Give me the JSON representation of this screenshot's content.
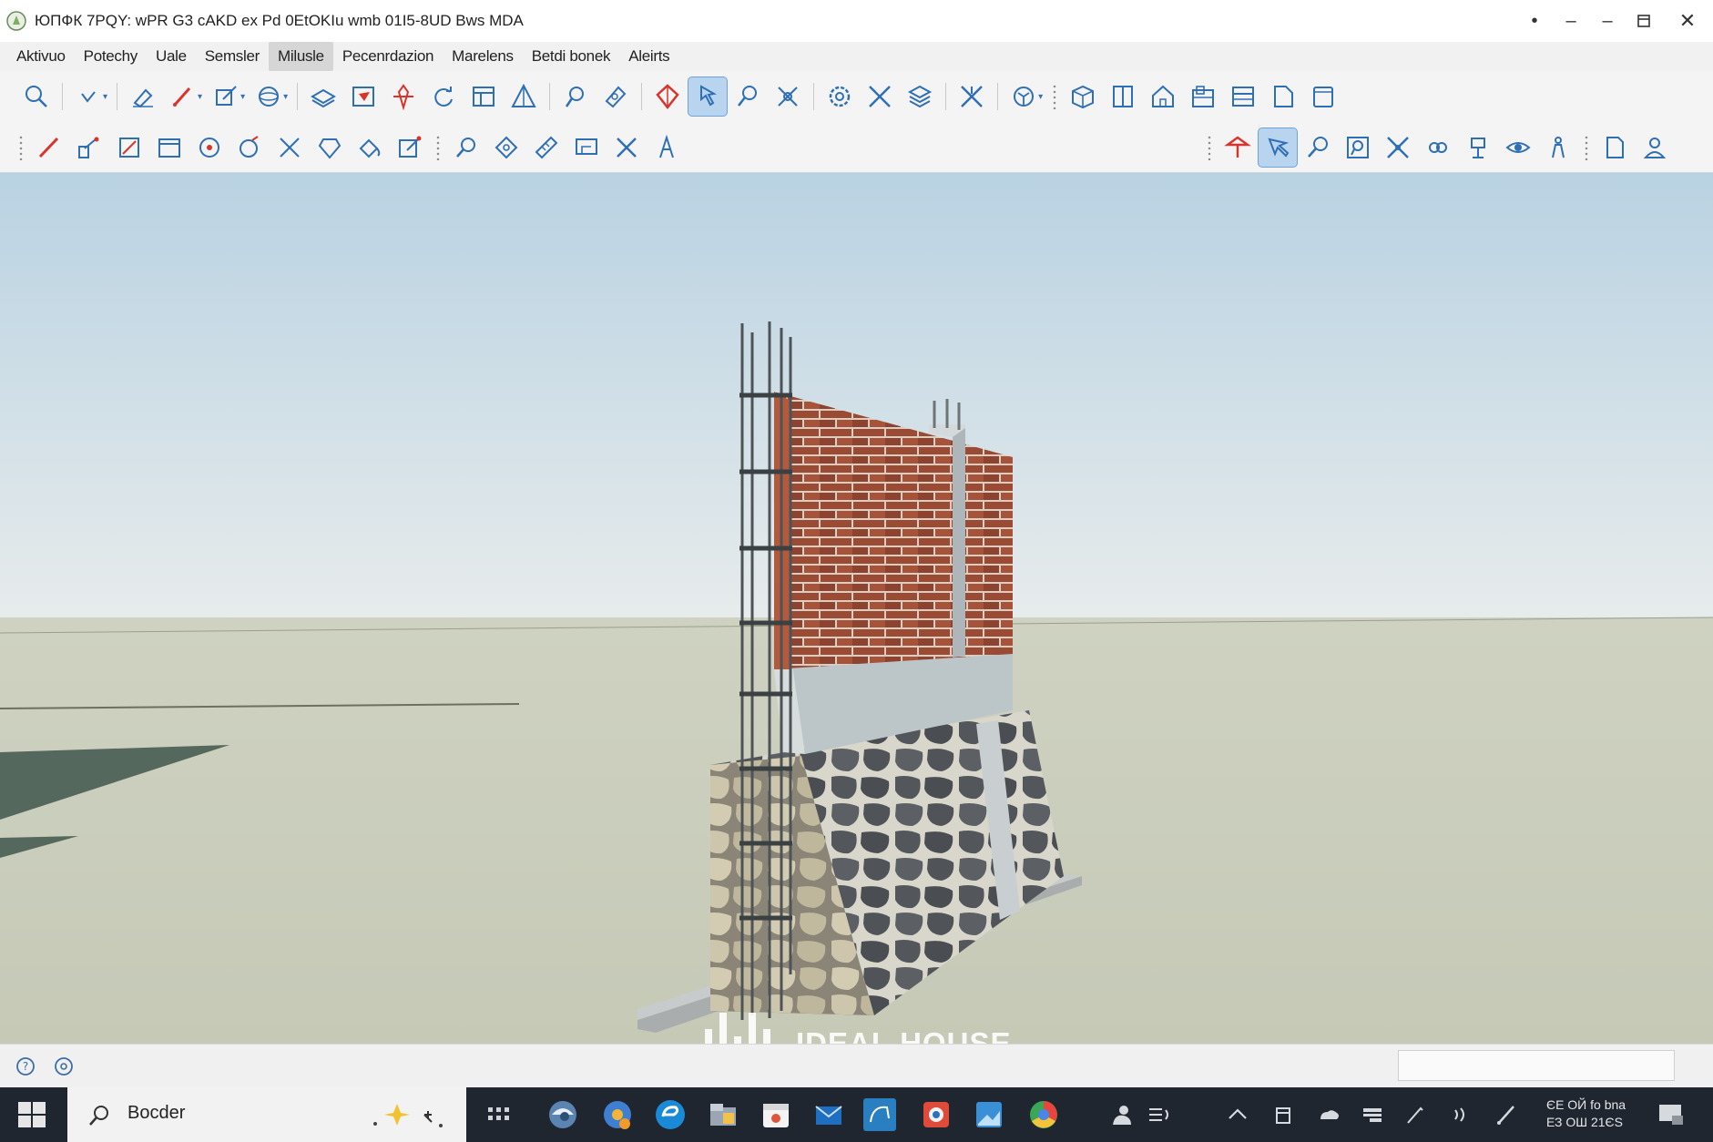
{
  "window": {
    "title": "ЮПФК 7PQY: wPR G3 cAKD ex Pd 0EtOKIu wmb 01I5-8UD Bws MDA"
  },
  "menu": [
    {
      "label": "Aktivuo"
    },
    {
      "label": "Potechy"
    },
    {
      "label": "Uale"
    },
    {
      "label": "Semsler"
    },
    {
      "label": "Milusle",
      "active": true
    },
    {
      "label": "Pecenrdazion"
    },
    {
      "label": "Marelens"
    },
    {
      "label": "Betdi bonek"
    },
    {
      "label": "Aleirts"
    }
  ],
  "toolbar1_icons": [
    "zoom-icon",
    "select-icon",
    "eraser-icon",
    "pencil-icon",
    "edit-icon",
    "orbit-icon",
    "layers-icon",
    "image-icon",
    "move-icon",
    "rotate-icon",
    "section-icon",
    "measure-icon",
    "search-icon",
    "paint-icon",
    "pushpull-icon",
    "follow-icon",
    "lookaround-icon",
    "tape-icon",
    "settings-icon",
    "scale-icon",
    "components-icon",
    "intersect-icon",
    "globe-icon",
    "box-icon",
    "door-icon",
    "house-icon",
    "building-icon",
    "window-icon",
    "file-icon",
    "page-icon"
  ],
  "toolbar2_icons": [
    "line-icon",
    "arc-icon",
    "rectangle-icon",
    "panel-icon",
    "circle-icon",
    "rotate-circle-icon",
    "cut-icon",
    "gem-icon",
    "paint-bucket-icon",
    "edit-box-icon",
    "magnify-icon",
    "star-icon",
    "ruler-icon",
    "dimension-icon",
    "cross-icon",
    "text-icon",
    "location-icon",
    "walk-icon",
    "zoom-window-icon",
    "frame-icon",
    "explode-icon",
    "link-icon",
    "figure-icon",
    "eye-icon",
    "person-icon",
    "doc-icon",
    "user-icon"
  ],
  "watermark": {
    "text": "IDEAL.HOUSE"
  },
  "taskbar": {
    "search_text": "Bocder",
    "clock_line1": "ЄЕ ОЙ fo bna",
    "clock_line2": "ЕЗ ОШ 21ЄЅ"
  },
  "colors": {
    "accent": "#2f6fb4",
    "active_tool_bg": "#b9d4ef",
    "sky_top": "#bcd3e1",
    "ground": "#c9cdbb",
    "brick": "#9b4a34",
    "taskbar": "#1f2630"
  }
}
